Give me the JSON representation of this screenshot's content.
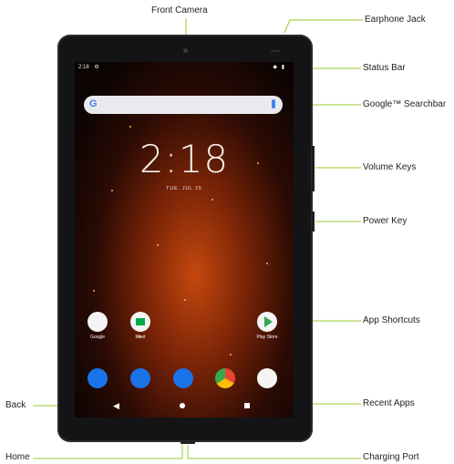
{
  "callouts": {
    "front_camera": "Front Camera",
    "earphone_jack": "Earphone Jack",
    "status_bar": "Status Bar",
    "searchbar": "Google™ Searchbar",
    "volume_keys": "Volume Keys",
    "power_key": "Power Key",
    "app_shortcuts": "App Shortcuts",
    "back": "Back",
    "recent_apps": "Recent Apps",
    "home": "Home",
    "charging_port": "Charging Port"
  },
  "screen": {
    "status_time": "2:18",
    "clock": "2:18",
    "date": "TUE, JUL 25",
    "apps": [
      "Google",
      "Meet",
      "Play Store"
    ]
  },
  "colors": {
    "leader_line": "#9acb2f",
    "tablet_body": "#141416"
  }
}
